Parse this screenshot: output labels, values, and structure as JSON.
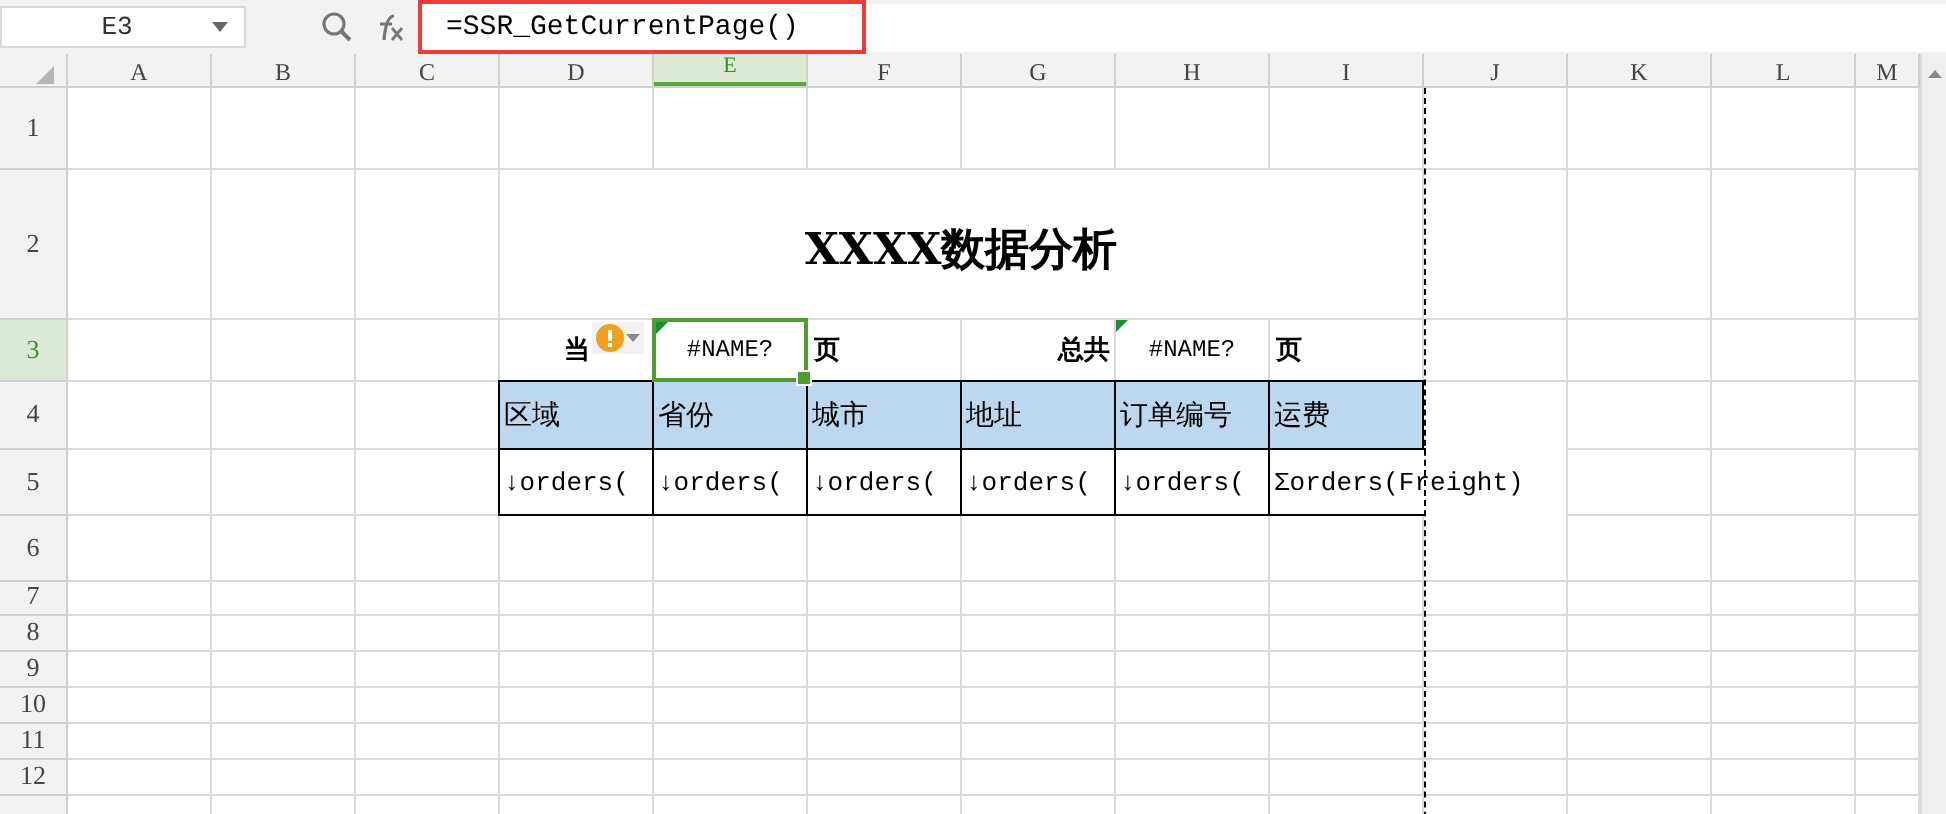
{
  "name_box": {
    "value": "E3"
  },
  "formula": {
    "value": "=SSR_GetCurrentPage()",
    "highlighted": true
  },
  "columns": [
    {
      "label": "A",
      "selected": false
    },
    {
      "label": "B",
      "selected": false
    },
    {
      "label": "C",
      "selected": false
    },
    {
      "label": "D",
      "selected": false
    },
    {
      "label": "E",
      "selected": true
    },
    {
      "label": "F",
      "selected": false
    },
    {
      "label": "G",
      "selected": false
    },
    {
      "label": "H",
      "selected": false
    },
    {
      "label": "I",
      "selected": false
    },
    {
      "label": "J",
      "selected": false
    },
    {
      "label": "K",
      "selected": false
    },
    {
      "label": "L",
      "selected": false
    },
    {
      "label": "M",
      "selected": false
    }
  ],
  "rows": [
    {
      "label": "1",
      "selected": false
    },
    {
      "label": "2",
      "selected": false
    },
    {
      "label": "3",
      "selected": true
    },
    {
      "label": "4",
      "selected": false
    },
    {
      "label": "5",
      "selected": false
    },
    {
      "label": "6",
      "selected": false
    },
    {
      "label": "7",
      "selected": false
    },
    {
      "label": "8",
      "selected": false
    },
    {
      "label": "9",
      "selected": false
    },
    {
      "label": "10",
      "selected": false
    },
    {
      "label": "11",
      "selected": false
    },
    {
      "label": "12",
      "selected": false
    }
  ],
  "report": {
    "title": "XXXX数据分析",
    "page_row": [
      {
        "kind": "prefix",
        "text": "当",
        "selected": false,
        "error_flag": false,
        "smart_tag": true
      },
      {
        "kind": "value",
        "text": "#NAME?",
        "selected": true,
        "error_flag": true,
        "smart_tag": false
      },
      {
        "kind": "suffix",
        "text": "页",
        "selected": false,
        "error_flag": false,
        "smart_tag": false
      },
      {
        "kind": "prefix",
        "text": "总共",
        "selected": false,
        "error_flag": false,
        "smart_tag": false
      },
      {
        "kind": "value",
        "text": "#NAME?",
        "selected": false,
        "error_flag": true,
        "smart_tag": false
      },
      {
        "kind": "suffix",
        "text": "页",
        "selected": false,
        "error_flag": false,
        "smart_tag": false
      }
    ],
    "header_row": [
      "区域",
      "省份",
      "城市",
      "地址",
      "订单编号",
      "运费"
    ],
    "detail_row": [
      "↓orders(",
      "↓orders(",
      "↓orders(",
      "↓orders(",
      "↓orders(",
      "Σorders(Freight)"
    ]
  }
}
